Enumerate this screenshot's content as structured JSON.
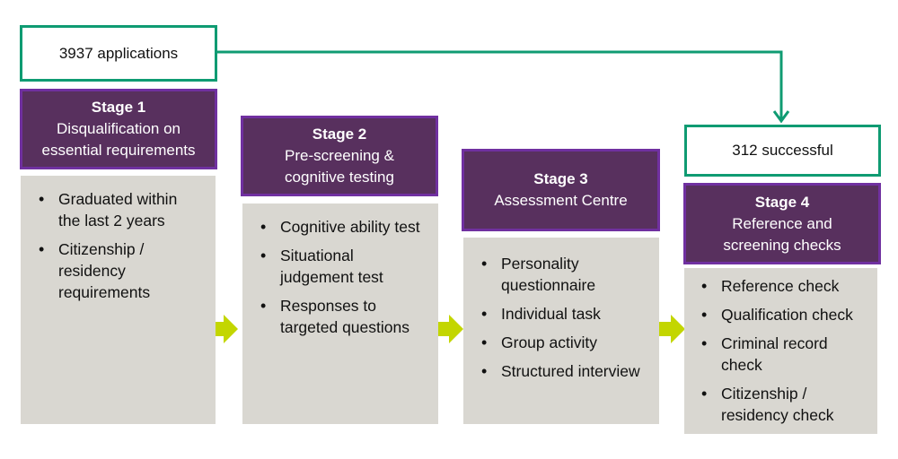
{
  "start_box": {
    "label": "3937 applications"
  },
  "end_box": {
    "label": "312 successful"
  },
  "colors": {
    "green": "#0f9b72",
    "purple_fill": "#58305e",
    "purple_border": "#7030a0",
    "gray": "#d9d7d1",
    "arrow": "#c3d600"
  },
  "stages": [
    {
      "title": "Stage 1",
      "subtitle_lines": [
        "Disqualification on",
        "essential requirements"
      ],
      "items": [
        "Graduated within the last 2 years",
        "Citizenship / residency requirements"
      ]
    },
    {
      "title": "Stage 2",
      "subtitle_lines": [
        "Pre-screening &",
        "cognitive testing"
      ],
      "items": [
        "Cognitive ability test",
        "Situational judgement test",
        "Responses to targeted questions"
      ]
    },
    {
      "title": "Stage 3",
      "subtitle_lines": [
        "Assessment Centre"
      ],
      "items": [
        "Personality questionnaire",
        "Individual task",
        "Group activity",
        "Structured interview"
      ]
    },
    {
      "title": "Stage 4",
      "subtitle_lines": [
        "Reference and",
        "screening checks"
      ],
      "items": [
        "Reference check",
        "Qualification check",
        "Criminal record check",
        "Citizenship / residency check"
      ]
    }
  ]
}
